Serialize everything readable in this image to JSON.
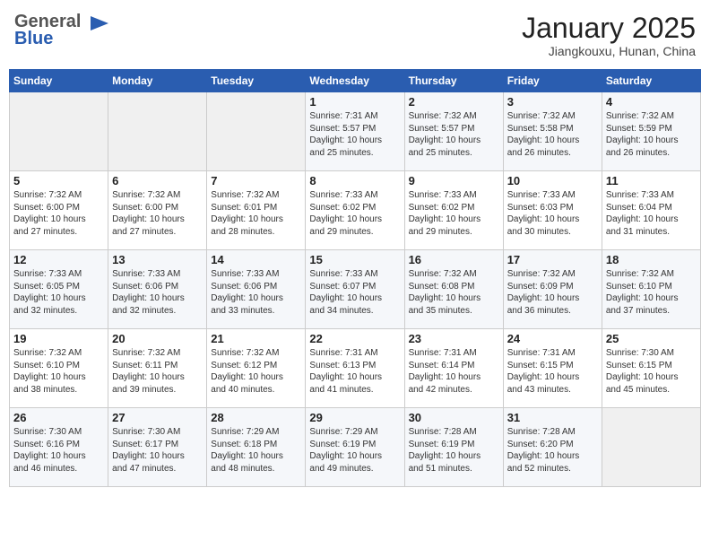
{
  "header": {
    "logo_line1": "General",
    "logo_line2": "Blue",
    "month_title": "January 2025",
    "location": "Jiangkouxu, Hunan, China"
  },
  "weekdays": [
    "Sunday",
    "Monday",
    "Tuesday",
    "Wednesday",
    "Thursday",
    "Friday",
    "Saturday"
  ],
  "weeks": [
    [
      {
        "day": "",
        "info": ""
      },
      {
        "day": "",
        "info": ""
      },
      {
        "day": "",
        "info": ""
      },
      {
        "day": "1",
        "info": "Sunrise: 7:31 AM\nSunset: 5:57 PM\nDaylight: 10 hours\nand 25 minutes."
      },
      {
        "day": "2",
        "info": "Sunrise: 7:32 AM\nSunset: 5:57 PM\nDaylight: 10 hours\nand 25 minutes."
      },
      {
        "day": "3",
        "info": "Sunrise: 7:32 AM\nSunset: 5:58 PM\nDaylight: 10 hours\nand 26 minutes."
      },
      {
        "day": "4",
        "info": "Sunrise: 7:32 AM\nSunset: 5:59 PM\nDaylight: 10 hours\nand 26 minutes."
      }
    ],
    [
      {
        "day": "5",
        "info": "Sunrise: 7:32 AM\nSunset: 6:00 PM\nDaylight: 10 hours\nand 27 minutes."
      },
      {
        "day": "6",
        "info": "Sunrise: 7:32 AM\nSunset: 6:00 PM\nDaylight: 10 hours\nand 27 minutes."
      },
      {
        "day": "7",
        "info": "Sunrise: 7:32 AM\nSunset: 6:01 PM\nDaylight: 10 hours\nand 28 minutes."
      },
      {
        "day": "8",
        "info": "Sunrise: 7:33 AM\nSunset: 6:02 PM\nDaylight: 10 hours\nand 29 minutes."
      },
      {
        "day": "9",
        "info": "Sunrise: 7:33 AM\nSunset: 6:02 PM\nDaylight: 10 hours\nand 29 minutes."
      },
      {
        "day": "10",
        "info": "Sunrise: 7:33 AM\nSunset: 6:03 PM\nDaylight: 10 hours\nand 30 minutes."
      },
      {
        "day": "11",
        "info": "Sunrise: 7:33 AM\nSunset: 6:04 PM\nDaylight: 10 hours\nand 31 minutes."
      }
    ],
    [
      {
        "day": "12",
        "info": "Sunrise: 7:33 AM\nSunset: 6:05 PM\nDaylight: 10 hours\nand 32 minutes."
      },
      {
        "day": "13",
        "info": "Sunrise: 7:33 AM\nSunset: 6:06 PM\nDaylight: 10 hours\nand 32 minutes."
      },
      {
        "day": "14",
        "info": "Sunrise: 7:33 AM\nSunset: 6:06 PM\nDaylight: 10 hours\nand 33 minutes."
      },
      {
        "day": "15",
        "info": "Sunrise: 7:33 AM\nSunset: 6:07 PM\nDaylight: 10 hours\nand 34 minutes."
      },
      {
        "day": "16",
        "info": "Sunrise: 7:32 AM\nSunset: 6:08 PM\nDaylight: 10 hours\nand 35 minutes."
      },
      {
        "day": "17",
        "info": "Sunrise: 7:32 AM\nSunset: 6:09 PM\nDaylight: 10 hours\nand 36 minutes."
      },
      {
        "day": "18",
        "info": "Sunrise: 7:32 AM\nSunset: 6:10 PM\nDaylight: 10 hours\nand 37 minutes."
      }
    ],
    [
      {
        "day": "19",
        "info": "Sunrise: 7:32 AM\nSunset: 6:10 PM\nDaylight: 10 hours\nand 38 minutes."
      },
      {
        "day": "20",
        "info": "Sunrise: 7:32 AM\nSunset: 6:11 PM\nDaylight: 10 hours\nand 39 minutes."
      },
      {
        "day": "21",
        "info": "Sunrise: 7:32 AM\nSunset: 6:12 PM\nDaylight: 10 hours\nand 40 minutes."
      },
      {
        "day": "22",
        "info": "Sunrise: 7:31 AM\nSunset: 6:13 PM\nDaylight: 10 hours\nand 41 minutes."
      },
      {
        "day": "23",
        "info": "Sunrise: 7:31 AM\nSunset: 6:14 PM\nDaylight: 10 hours\nand 42 minutes."
      },
      {
        "day": "24",
        "info": "Sunrise: 7:31 AM\nSunset: 6:15 PM\nDaylight: 10 hours\nand 43 minutes."
      },
      {
        "day": "25",
        "info": "Sunrise: 7:30 AM\nSunset: 6:15 PM\nDaylight: 10 hours\nand 45 minutes."
      }
    ],
    [
      {
        "day": "26",
        "info": "Sunrise: 7:30 AM\nSunset: 6:16 PM\nDaylight: 10 hours\nand 46 minutes."
      },
      {
        "day": "27",
        "info": "Sunrise: 7:30 AM\nSunset: 6:17 PM\nDaylight: 10 hours\nand 47 minutes."
      },
      {
        "day": "28",
        "info": "Sunrise: 7:29 AM\nSunset: 6:18 PM\nDaylight: 10 hours\nand 48 minutes."
      },
      {
        "day": "29",
        "info": "Sunrise: 7:29 AM\nSunset: 6:19 PM\nDaylight: 10 hours\nand 49 minutes."
      },
      {
        "day": "30",
        "info": "Sunrise: 7:28 AM\nSunset: 6:19 PM\nDaylight: 10 hours\nand 51 minutes."
      },
      {
        "day": "31",
        "info": "Sunrise: 7:28 AM\nSunset: 6:20 PM\nDaylight: 10 hours\nand 52 minutes."
      },
      {
        "day": "",
        "info": ""
      }
    ]
  ]
}
